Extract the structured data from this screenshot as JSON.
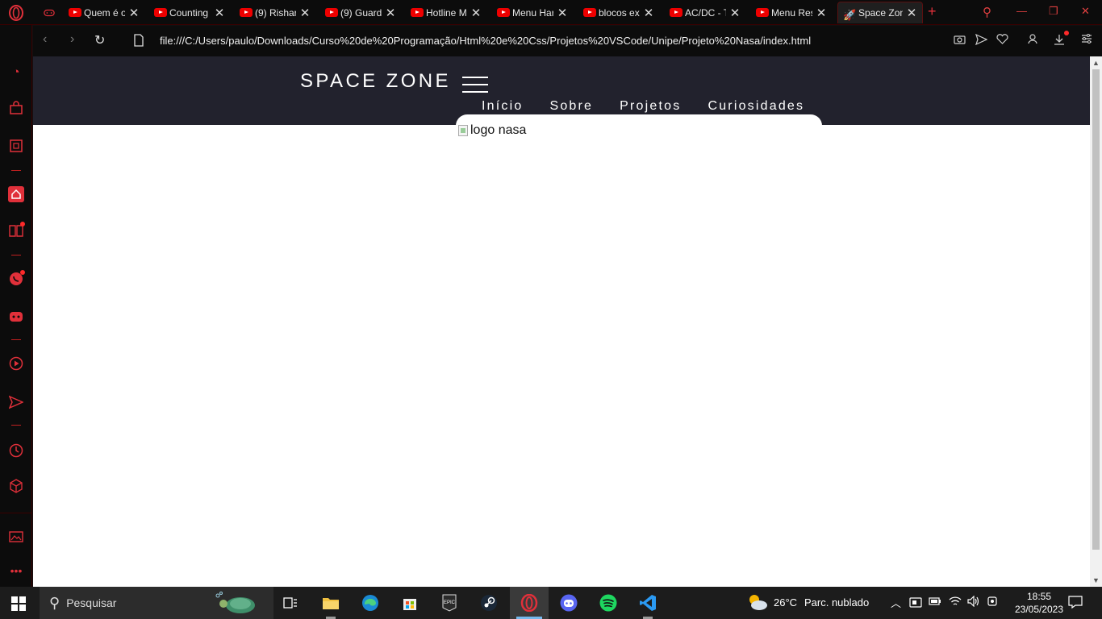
{
  "tabs": [
    {
      "title": "Quem é o",
      "kind": "youtube"
    },
    {
      "title": "Counting",
      "kind": "youtube"
    },
    {
      "title": "(9) Rishar",
      "kind": "youtube"
    },
    {
      "title": "(9) Guard",
      "kind": "youtube"
    },
    {
      "title": "Hotline M",
      "kind": "youtube"
    },
    {
      "title": "Menu Har",
      "kind": "youtube"
    },
    {
      "title": "blocos exp",
      "kind": "youtube"
    },
    {
      "title": "AC/DC - T",
      "kind": "youtube"
    },
    {
      "title": "Menu Res",
      "kind": "youtube"
    },
    {
      "title": "Space Zon",
      "kind": "rocket",
      "active": true
    }
  ],
  "address": {
    "url": "file:///C:/Users/paulo/Downloads/Curso%20de%20Programação/Html%20e%20Css/Projetos%20VSCode/Unipe/Projeto%20Nasa/index.html"
  },
  "page": {
    "brand": "SPACE ZONE",
    "nav": [
      "Início",
      "Sobre",
      "Projetos",
      "Curiosidades"
    ],
    "logo_alt": "logo nasa",
    "header_color": "#22222d"
  },
  "taskbar": {
    "search_placeholder": "Pesquisar",
    "weather_temp": "26°C",
    "weather_text": "Parc. nublado",
    "time": "18:55",
    "date": "23/05/2023"
  },
  "colors": {
    "opera_accent": "#e0303a",
    "page_background": "#ffffff"
  }
}
